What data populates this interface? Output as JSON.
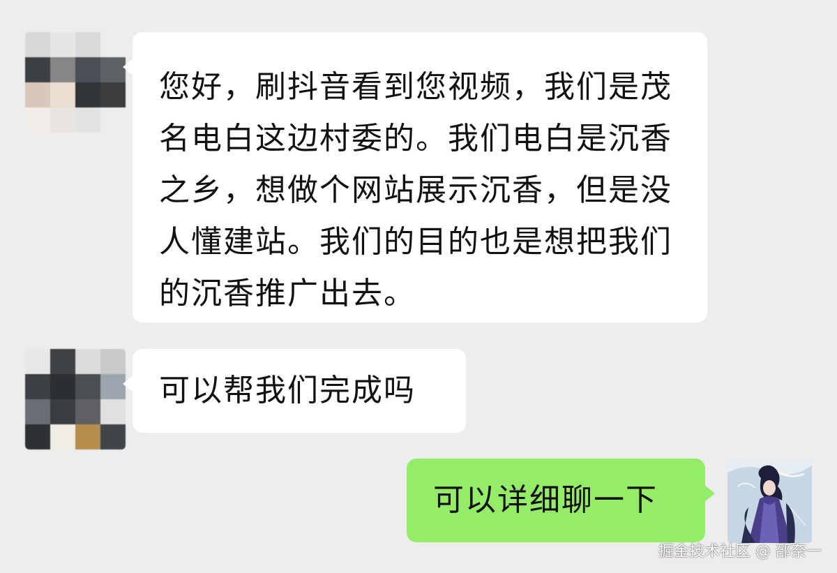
{
  "colors": {
    "background": "#ededed",
    "incoming_bubble": "#ffffff",
    "outgoing_bubble": "#95ec69",
    "text": "#111111"
  },
  "messages": [
    {
      "direction": "incoming",
      "text": "您好，刷抖音看到您视频，我们是茂名电白这边村委的。我们电白是沉香之乡，想做个网站展示沉香，但是没人懂建站。我们的目的也是想把我们的沉香推广出去。"
    },
    {
      "direction": "incoming",
      "text": "可以帮我们完成吗"
    },
    {
      "direction": "outgoing",
      "text": "可以详细聊一下"
    }
  ],
  "avatars": {
    "contact": "pixelated-avatar",
    "me": "anime-character-avatar"
  },
  "watermark": {
    "text": "掘金技术社区 @ 邵奈一"
  }
}
